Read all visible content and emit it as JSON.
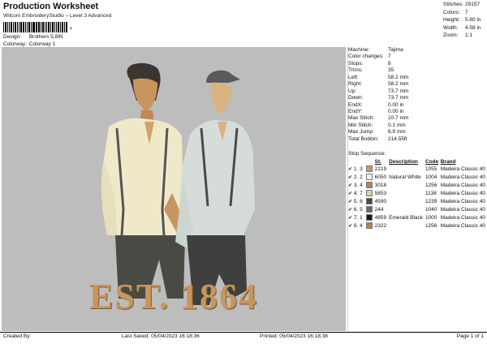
{
  "header": {
    "title": "Production Worksheet",
    "subtitle": "Wilcom EmbroideryStudio – Level 3 Advanced",
    "barcode_tail": ",",
    "design_label": "Design:",
    "design_value": "Brothers 5,8IN",
    "colorway_label": "Colorway:",
    "colorway_value": "Colorway 1"
  },
  "stats": [
    {
      "label": "Stitches:",
      "value": "29157"
    },
    {
      "label": "Colors:",
      "value": "7"
    },
    {
      "label": "Height:",
      "value": "5.80 in"
    },
    {
      "label": "Width:",
      "value": "4.58 in"
    },
    {
      "label": "Zoom:",
      "value": "1:1"
    }
  ],
  "design": {
    "text": "EST. 1864",
    "background": "#bdbdbd",
    "text_color": "#c8955a"
  },
  "machine": [
    {
      "label": "Machine:",
      "value": "Tajima"
    },
    {
      "label": "Color changes:",
      "value": "7"
    },
    {
      "label": "Stops:",
      "value": "8"
    },
    {
      "label": "Trims:",
      "value": "35"
    },
    {
      "label": "Left:",
      "value": "58.2 mm"
    },
    {
      "label": "Right:",
      "value": "58.2 mm"
    },
    {
      "label": "Up:",
      "value": "73.7 mm"
    },
    {
      "label": "Down:",
      "value": "73.7 mm"
    },
    {
      "label": "EndX:",
      "value": "0.00 in"
    },
    {
      "label": "EndY:",
      "value": "0.00 in"
    },
    {
      "label": "Max Stitch:",
      "value": "10.7 mm"
    },
    {
      "label": "Min Stitch:",
      "value": "0.1 mm"
    },
    {
      "label": "Max Jump:",
      "value": "6.9 mm"
    },
    {
      "label": "Total Bobbin:",
      "value": "214.55ft"
    }
  ],
  "stop_sequence": {
    "heading": "Stop Sequence:",
    "columns": [
      "St.",
      "Description",
      "Code",
      "Brand"
    ],
    "rows": [
      {
        "stop": "1.",
        "n": "3",
        "st": "2219",
        "desc": "",
        "code": "1055",
        "brand": "Madeira Classic 40",
        "color": "#c89a6a"
      },
      {
        "stop": "2.",
        "n": "2",
        "st": "6050",
        "desc": "Natural White",
        "code": "1004",
        "brand": "Madeira Classic 40",
        "color": "#f2f0e8"
      },
      {
        "stop": "3.",
        "n": "4",
        "st": "3018",
        "desc": "",
        "code": "1256",
        "brand": "Madeira Classic 40",
        "color": "#b8804e"
      },
      {
        "stop": "4.",
        "n": "7",
        "st": "5853",
        "desc": "",
        "code": "1138",
        "brand": "Madeira Classic 40",
        "color": "#d8cfae"
      },
      {
        "stop": "5.",
        "n": "6",
        "st": "4590",
        "desc": "",
        "code": "1239",
        "brand": "Madeira Classic 40",
        "color": "#4a4a4a"
      },
      {
        "stop": "6.",
        "n": "5",
        "st": "244",
        "desc": "",
        "code": "1040",
        "brand": "Madeira Classic 40",
        "color": "#6a6a6a"
      },
      {
        "stop": "7.",
        "n": "1",
        "st": "4859",
        "desc": "Emerald Black",
        "code": "1000",
        "brand": "Madeira Classic 40",
        "color": "#1a1a1a"
      },
      {
        "stop": "8.",
        "n": "4",
        "st": "2322",
        "desc": "",
        "code": "1256",
        "brand": "Madeira Classic 40",
        "color": "#b8804e"
      }
    ]
  },
  "footer": {
    "created": "Created By:",
    "last_saved": "Last Saved: 05/04/2023 16:18:36",
    "printed": "Printed: 05/04/2023 16:18:38",
    "page": "Page 1 of 1"
  }
}
